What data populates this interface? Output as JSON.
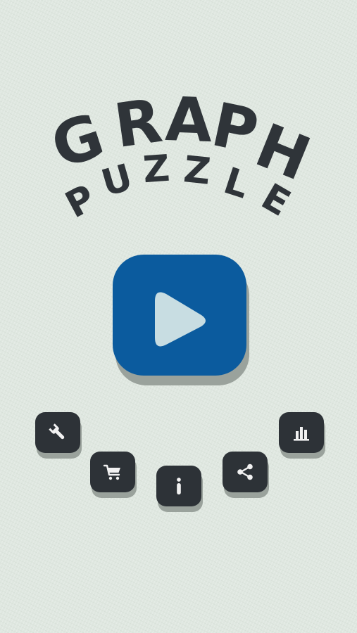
{
  "title": {
    "line1": "GRAPH",
    "line2": "PUZZLE",
    "line1_letters": [
      "G",
      "R",
      "A",
      "P",
      "H"
    ],
    "line2_letters": [
      "P",
      "U",
      "Z",
      "Z",
      "L",
      "E"
    ]
  },
  "colors": {
    "background": "#dfe7e0",
    "title_text": "#2f3439",
    "play_button": "#0b5b9e",
    "play_icon": "#c8dde2",
    "small_button": "#2d3237",
    "icon_fill": "#f2f2f2",
    "shadow": "#9aa29c"
  },
  "buttons": {
    "play": {
      "icon": "play-icon"
    },
    "menu": [
      {
        "id": "settings",
        "icon": "wrench-icon"
      },
      {
        "id": "shop",
        "icon": "shopping-cart-icon"
      },
      {
        "id": "info",
        "icon": "info-icon"
      },
      {
        "id": "share",
        "icon": "share-icon"
      },
      {
        "id": "stats",
        "icon": "bar-chart-icon"
      }
    ]
  }
}
